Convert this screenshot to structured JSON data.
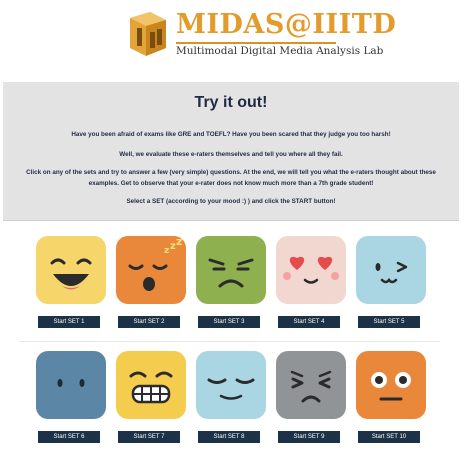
{
  "header": {
    "logo_title": "MIDAS@IIITD",
    "logo_subtitle": "Multimodal Digital Media Analysis Lab"
  },
  "intro": {
    "title": "Try it out!",
    "paragraphs": [
      "Have you been afraid of exams like GRE and TOEFL? Have you been scared that they judge you too harsh!",
      "Well, we evaluate these e-raters themselves and tell you where all they fail.",
      "Click on any of the sets and try to answer a few (very simple) questions. At the end, we will tell you what the e-raters thought about these",
      "examples. Get to observe that your e-rater does not know much more than a 7th grade student!",
      "Select a SET (according to your mood :) ) and click the START button!"
    ]
  },
  "sets": [
    {
      "label": "Start SET 1",
      "icon": "grinning-face-icon",
      "color": "#f6d66a"
    },
    {
      "label": "Start SET 2",
      "icon": "sleeping-face-icon",
      "color": "#e9873a"
    },
    {
      "label": "Start SET 3",
      "icon": "frowning-face-icon",
      "color": "#8fb04f"
    },
    {
      "label": "Start SET 4",
      "icon": "heart-eyes-face-icon",
      "color": "#f1d7cf"
    },
    {
      "label": "Start SET 5",
      "icon": "winking-face-icon",
      "color": "#a9d6e2"
    },
    {
      "label": "Start SET 6",
      "icon": "neutral-face-icon",
      "color": "#5c86a6"
    },
    {
      "label": "Start SET 7",
      "icon": "grimacing-face-icon",
      "color": "#f4cc4e"
    },
    {
      "label": "Start SET 8",
      "icon": "relieved-face-icon",
      "color": "#a9d6e2"
    },
    {
      "label": "Start SET 9",
      "icon": "persevering-face-icon",
      "color": "#909497"
    },
    {
      "label": "Start SET 10",
      "icon": "surprised-face-icon",
      "color": "#e9873a"
    }
  ],
  "colors": {
    "brand_orange": "#e39b2c",
    "panel_bg": "#e3e3e3",
    "title_navy": "#1f2a44",
    "button_bg": "#1c3347"
  }
}
